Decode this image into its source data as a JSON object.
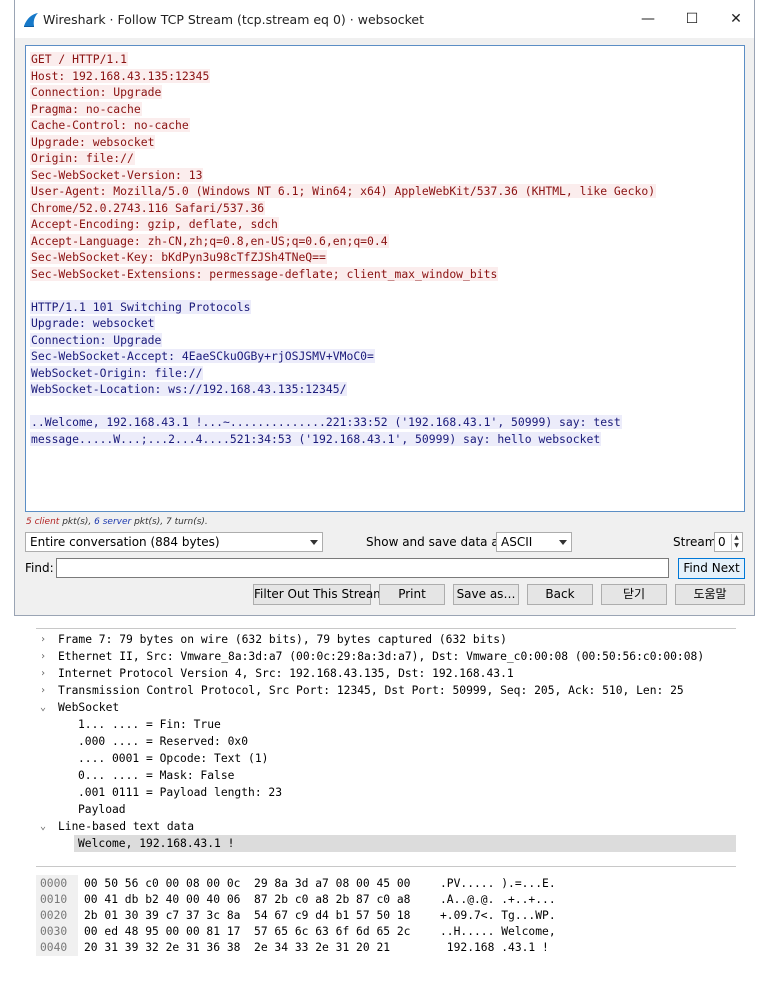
{
  "window": {
    "title": "Wireshark · Follow TCP Stream (tcp.stream eq 0) · websocket",
    "minimize": "—",
    "maximize": "☐",
    "close": "✕"
  },
  "stream": {
    "client_lines": [
      "GET / HTTP/1.1",
      "Host: 192.168.43.135:12345",
      "Connection: Upgrade",
      "Pragma: no-cache",
      "Cache-Control: no-cache",
      "Upgrade: websocket",
      "Origin: file://",
      "Sec-WebSocket-Version: 13",
      "User-Agent: Mozilla/5.0 (Windows NT 6.1; Win64; x64) AppleWebKit/537.36 (KHTML, like Gecko)",
      "Chrome/52.0.2743.116 Safari/537.36",
      "Accept-Encoding: gzip, deflate, sdch",
      "Accept-Language: zh-CN,zh;q=0.8,en-US;q=0.6,en;q=0.4",
      "Sec-WebSocket-Key: bKdPyn3u98cTfZJSh4TNeQ==",
      "Sec-WebSocket-Extensions: permessage-deflate; client_max_window_bits"
    ],
    "server_lines": [
      "HTTP/1.1 101 Switching Protocols",
      "Upgrade: websocket",
      "Connection: Upgrade",
      "Sec-WebSocket-Accept: 4EaeSCkuOGBy+rjOSJSMV+VMoC0=",
      "WebSocket-Origin: file://",
      "WebSocket-Location: ws://192.168.43.135:12345/"
    ],
    "data_lines": [
      "..Welcome, 192.168.43.1 !...~..............221:33:52 ('192.168.43.1', 50999) say: test",
      "message.....W...;...2...4....521:34:53 ('192.168.43.1', 50999) say: hello websocket"
    ]
  },
  "stats": {
    "client_count": "5",
    "client_word": "client",
    "middle": "pkt(s), ",
    "server_count": "6",
    "server_word": "server",
    "tail": "pkt(s), 7 turn(s)."
  },
  "controls": {
    "conversation": "Entire conversation (884 bytes)",
    "show_save_label": "Show and save data as",
    "format": "ASCII",
    "stream_label": "Stream",
    "stream_value": "0",
    "find_label": "Find:",
    "find_value": "",
    "find_next": "Find Next",
    "filter_out": "Filter Out This Stream",
    "print": "Print",
    "save_as": "Save as…",
    "back": "Back",
    "close": "닫기",
    "help": "도움말"
  },
  "details": [
    {
      "level": 0,
      "twisty": "›",
      "text": "Frame 7: 79 bytes on wire (632 bits), 79 bytes captured (632 bits)"
    },
    {
      "level": 0,
      "twisty": "›",
      "text": "Ethernet II, Src: Vmware_8a:3d:a7 (00:0c:29:8a:3d:a7), Dst: Vmware_c0:00:08 (00:50:56:c0:00:08)"
    },
    {
      "level": 0,
      "twisty": "›",
      "text": "Internet Protocol Version 4, Src: 192.168.43.135, Dst: 192.168.43.1"
    },
    {
      "level": 0,
      "twisty": "›",
      "text": "Transmission Control Protocol, Src Port: 12345, Dst Port: 50999, Seq: 205, Ack: 510, Len: 25"
    },
    {
      "level": 0,
      "twisty": "⌄",
      "text": "WebSocket"
    },
    {
      "level": 1,
      "twisty": "",
      "text": "1... .... = Fin: True"
    },
    {
      "level": 1,
      "twisty": "",
      "text": ".000 .... = Reserved: 0x0"
    },
    {
      "level": 1,
      "twisty": "",
      "text": ".... 0001 = Opcode: Text (1)"
    },
    {
      "level": 1,
      "twisty": "",
      "text": "0... .... = Mask: False"
    },
    {
      "level": 1,
      "twisty": "",
      "text": ".001 0111 = Payload length: 23"
    },
    {
      "level": 1,
      "twisty": "",
      "text": "Payload"
    },
    {
      "level": 0,
      "twisty": "⌄",
      "text": "Line-based text data"
    },
    {
      "level": 1,
      "twisty": "",
      "text": "Welcome, 192.168.43.1 !",
      "selected": true
    }
  ],
  "hex": [
    {
      "offset": "0000",
      "bytes": "00 50 56 c0 00 08 00 0c  29 8a 3d a7 08 00 45 00",
      "ascii": ".PV..... ).=...E."
    },
    {
      "offset": "0010",
      "bytes": "00 41 db b2 40 00 40 06  87 2b c0 a8 2b 87 c0 a8",
      "ascii": ".A..@.@. .+..+..."
    },
    {
      "offset": "0020",
      "bytes": "2b 01 30 39 c7 37 3c 8a  54 67 c9 d4 b1 57 50 18",
      "ascii": "+.09.7<. Tg...WP."
    },
    {
      "offset": "0030",
      "bytes": "00 ed 48 95 00 00 81 17  57 65 6c 63 6f 6d 65 2c",
      "ascii": "..H..... Welcome,"
    },
    {
      "offset": "0040",
      "bytes": "20 31 39 32 2e 31 36 38  2e 34 33 2e 31 20 21",
      "ascii": " 192.168 .43.1 !"
    }
  ]
}
